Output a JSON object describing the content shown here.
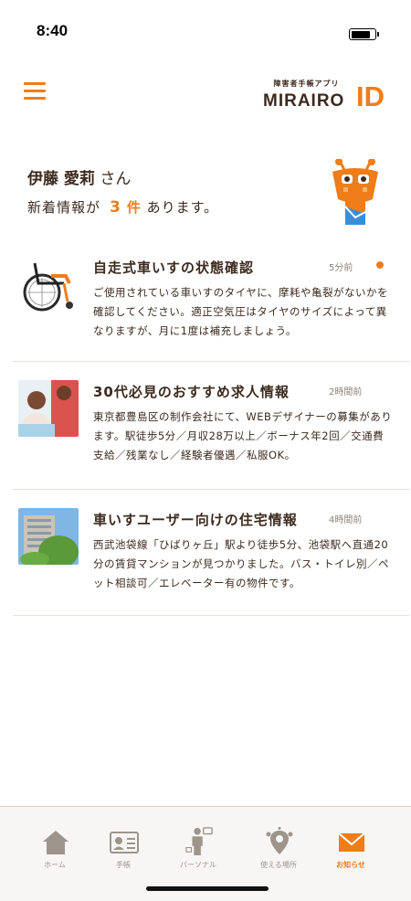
{
  "status_bar": {
    "time": "8:40",
    "battery_level": 0.85
  },
  "header": {
    "menu_icon": "hamburger-menu-icon",
    "brand_subtitle": "障害者手帳アプリ",
    "brand_name": "MIRAIRO",
    "brand_mark": "ID"
  },
  "greeting": {
    "user_name": "伊藤 愛莉",
    "honorific": "さん",
    "prefix": "新着情報が",
    "count": "3",
    "counter": "件",
    "suffix": "あります。"
  },
  "notifications": [
    {
      "title": "自走式車いすの状態確認",
      "time": "5分前",
      "unread": true,
      "thumbnail": "wheelchair",
      "body": "ご使用されている車いすのタイヤに、摩耗や亀裂がないかを確認してください。適正空気圧はタイヤのサイズによって異なりますが、月に1度は補充しましょう。"
    },
    {
      "title": "30代必見のおすすめ求人情報",
      "time": "2時間前",
      "unread": false,
      "thumbnail": "office-workers",
      "body": "東京都豊島区の制作会社にて、WEBデザイナーの募集があります。駅徒歩5分／月収28万以上／ボーナス年2回／交通費支給／残業なし／経験者優遇／私服OK。"
    },
    {
      "title": "車いすユーザー向けの住宅情報",
      "time": "4時間前",
      "unread": false,
      "thumbnail": "apartment-building",
      "body": "西武池袋線「ひばりヶ丘」駅より徒歩5分、池袋駅へ直通20分の賃貸マンションが見つかりました。バス・トイレ別／ペット相談可／エレベーター有の物件です。"
    }
  ],
  "tabs": [
    {
      "label": "ホーム",
      "icon": "home-icon",
      "active": false
    },
    {
      "label": "手帳",
      "icon": "id-card-icon",
      "active": false
    },
    {
      "label": "パーソナル",
      "icon": "person-icon",
      "active": false
    },
    {
      "label": "使える場所",
      "icon": "location-pin-icon",
      "active": false
    },
    {
      "label": "お知らせ",
      "icon": "mail-icon",
      "active": true
    }
  ],
  "colors": {
    "accent": "#ef7d1a",
    "text": "#3c2a1e",
    "muted": "#9d948c"
  }
}
